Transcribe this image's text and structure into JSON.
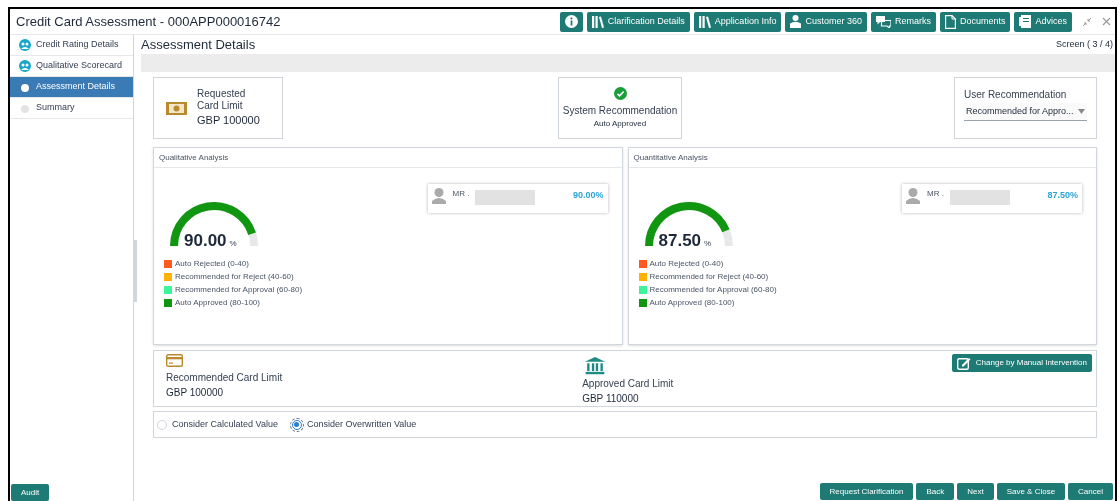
{
  "window": {
    "title": "Credit Card Assessment - 000APP000016742"
  },
  "toolbar": [
    {
      "label": "Clarification Details"
    },
    {
      "label": "Application Info"
    },
    {
      "label": "Customer 360"
    },
    {
      "label": "Remarks"
    },
    {
      "label": "Documents"
    },
    {
      "label": "Advices"
    }
  ],
  "sidebar": {
    "items": [
      {
        "label": "Credit Rating Details",
        "completed": true,
        "selected": false
      },
      {
        "label": "Qualitative Scorecard",
        "completed": true,
        "selected": false
      },
      {
        "label": "Assessment Details",
        "completed": false,
        "selected": true
      },
      {
        "label": "Summary",
        "completed": false,
        "selected": false
      }
    ]
  },
  "page": {
    "title": "Assessment Details",
    "screen": "Screen ( 3 / 4)"
  },
  "summary": {
    "requested": {
      "label": "Requested Card Limit",
      "value": "GBP 100000"
    },
    "system": {
      "label": "System Recommendation",
      "value": "Auto Approved"
    },
    "user": {
      "label": "User Recommendation",
      "value": "Recommended for Appro..."
    }
  },
  "analysis": [
    {
      "title": "Qualitative Analysis",
      "score": "90.00",
      "unit": "%",
      "person": "MR .",
      "percent": "90.00%",
      "legend": [
        {
          "label": "Auto Rejected (0-40)",
          "color": "#ff5a1f"
        },
        {
          "label": "Recommended for Reject (40-60)",
          "color": "#ffb300"
        },
        {
          "label": "Recommended for Approval (60-80)",
          "color": "#3cf59a"
        },
        {
          "label": "Auto Approved (80-100)",
          "color": "#109610"
        }
      ]
    },
    {
      "title": "Quantitative Analysis",
      "score": "87.50",
      "unit": "%",
      "person": "MR .",
      "percent": "87.50%",
      "legend": [
        {
          "label": "Auto Rejected (0-40)",
          "color": "#ff5a1f"
        },
        {
          "label": "Recommended for Reject (40-60)",
          "color": "#ffb300"
        },
        {
          "label": "Recommended for Approval (60-80)",
          "color": "#3cf59a"
        },
        {
          "label": "Auto Approved (80-100)",
          "color": "#109610"
        }
      ]
    }
  ],
  "limits": {
    "recommended": {
      "label": "Recommended Card Limit",
      "value": "GBP 100000"
    },
    "approved": {
      "label": "Approved Card Limit",
      "value": "GBP 110000"
    },
    "button": "Change by Manual Intervention"
  },
  "options": [
    {
      "label": "Consider Calculated Value",
      "selected": false
    },
    {
      "label": "Consider Overwritten Value",
      "selected": true
    }
  ],
  "footer": {
    "left": [
      "Audit"
    ],
    "right": [
      "Request Clarification",
      "Back",
      "Next",
      "Save & Close",
      "Cancel"
    ]
  }
}
